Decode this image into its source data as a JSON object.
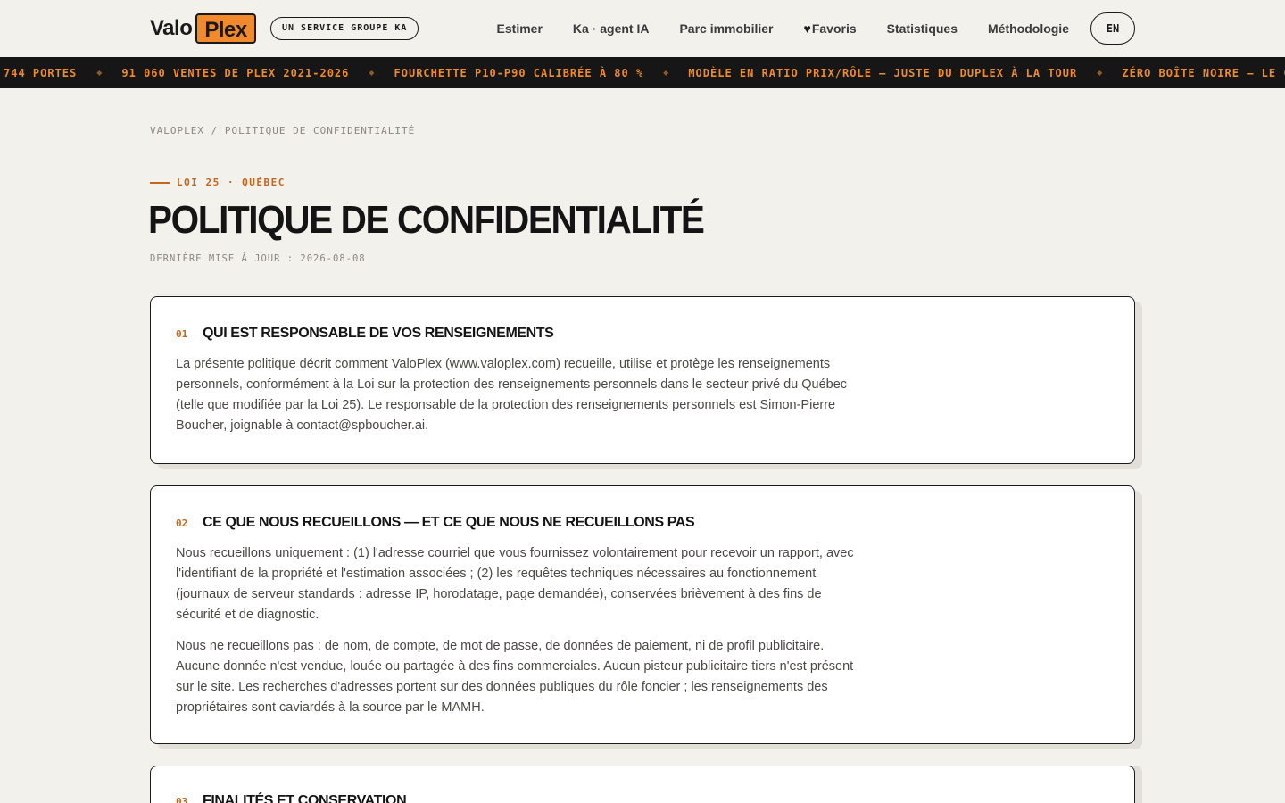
{
  "header": {
    "logo_part1": "Valo",
    "logo_part2": "Plex",
    "service_badge": "UN SERVICE GROUPE KA",
    "nav": [
      {
        "label": "Estimer"
      },
      {
        "label": "Ka · agent IA"
      },
      {
        "label": "Parc immobilier"
      },
      {
        "label": "Favoris",
        "icon": "heart-icon"
      },
      {
        "label": "Statistiques"
      },
      {
        "label": "Méthodologie"
      }
    ],
    "lang": "EN"
  },
  "ticker": [
    "744 PORTES",
    "91 060 VENTES DE PLEX 2021-2026",
    "FOURCHETTE P10-P90 CALIBRÉE À 80 %",
    "MODÈLE EN RATIO PRIX/RÔLE — JUSTE DU DUPLEX À LA TOUR",
    "ZÉRO BOÎTE NOIRE — LE CAL"
  ],
  "breadcrumb": {
    "home": "VALOPLEX",
    "separator": "/",
    "current": "POLITIQUE DE CONFIDENTIALITÉ"
  },
  "eyebrow": "LOI 25 · QUÉBEC",
  "title": "POLITIQUE DE CONFIDENTIALITÉ",
  "updated": "DERNIÈRE MISE À JOUR : 2026-08-08",
  "sections": [
    {
      "num": "01",
      "title": "QUI EST RESPONSABLE DE VOS RENSEIGNEMENTS",
      "paragraphs": [
        "La présente politique décrit comment ValoPlex (www.valoplex.com) recueille, utilise et protège les renseignements personnels, conformément à la Loi sur la protection des renseignements personnels dans le secteur privé du Québec (telle que modifiée par la Loi 25). Le responsable de la protection des renseignements personnels est Simon-Pierre Boucher, joignable à contact@spboucher.ai."
      ]
    },
    {
      "num": "02",
      "title": "CE QUE NOUS RECUEILLONS — ET CE QUE NOUS NE RECUEILLONS PAS",
      "paragraphs": [
        "Nous recueillons uniquement : (1) l'adresse courriel que vous fournissez volontairement pour recevoir un rapport, avec l'identifiant de la propriété et l'estimation associées ; (2) les requêtes techniques nécessaires au fonctionnement (journaux de serveur standards : adresse IP, horodatage, page demandée), conservées brièvement à des fins de sécurité et de diagnostic.",
        "Nous ne recueillons pas : de nom, de compte, de mot de passe, de données de paiement, ni de profil publicitaire. Aucune donnée n'est vendue, louée ou partagée à des fins commerciales. Aucun pisteur publicitaire tiers n'est présent sur le site. Les recherches d'adresses portent sur des données publiques du rôle foncier ; les renseignements des propriétaires sont caviardés à la source par le MAMH."
      ]
    },
    {
      "num": "03",
      "title": "FINALITÉS ET CONSERVATION",
      "paragraphs": []
    }
  ]
}
